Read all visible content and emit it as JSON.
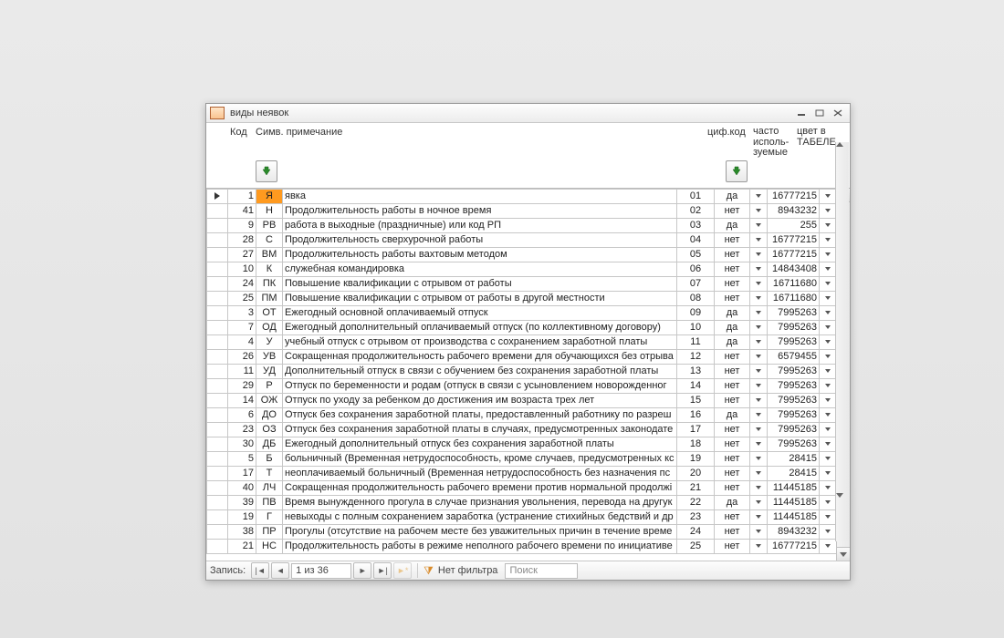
{
  "window": {
    "title": "виды неявок"
  },
  "headers": {
    "kod": "Код",
    "symb": "Симв. примечание",
    "cif": "циф.код",
    "chasto": "часто исполь- зуемые",
    "cvet": "цвет в ТАБЕЛЕ"
  },
  "nav": {
    "label": "Запись:",
    "pos": "1 из 36",
    "filter": "Нет фильтра",
    "search": "Поиск"
  },
  "rows": [
    {
      "sel": true,
      "code": "1",
      "symb": "Я",
      "desc": "явка",
      "cif": "01",
      "freq": "да",
      "color": "16777215"
    },
    {
      "code": "41",
      "symb": "Н",
      "desc": "Продолжительность работы в ночное время",
      "cif": "02",
      "freq": "нет",
      "color": "8943232"
    },
    {
      "code": "9",
      "symb": "РВ",
      "desc": "работа в выходные (праздничные) или код РП",
      "cif": "03",
      "freq": "да",
      "color": "255"
    },
    {
      "code": "28",
      "symb": "С",
      "desc": "Продолжительность сверхурочной работы",
      "cif": "04",
      "freq": "нет",
      "color": "16777215"
    },
    {
      "code": "27",
      "symb": "ВМ",
      "desc": "Продолжительность работы вахтовым методом",
      "cif": "05",
      "freq": "нет",
      "color": "16777215"
    },
    {
      "code": "10",
      "symb": "К",
      "desc": "служебная командировка",
      "cif": "06",
      "freq": "нет",
      "color": "14843408"
    },
    {
      "code": "24",
      "symb": "ПК",
      "desc": "Повышение квалификации с отрывом от работы",
      "cif": "07",
      "freq": "нет",
      "color": "16711680"
    },
    {
      "code": "25",
      "symb": "ПМ",
      "desc": "Повышение квалификации с отрывом от работы в другой местности",
      "cif": "08",
      "freq": "нет",
      "color": "16711680"
    },
    {
      "code": "3",
      "symb": "ОТ",
      "desc": "Ежегодный основной оплачиваемый отпуск",
      "cif": "09",
      "freq": "да",
      "color": "7995263"
    },
    {
      "code": "7",
      "symb": "ОД",
      "desc": "Ежегодный дополнительный оплачиваемый отпуск (по коллективному договору)",
      "cif": "10",
      "freq": "да",
      "color": "7995263"
    },
    {
      "code": "4",
      "symb": "У",
      "desc": "учебный отпуск с отрывом от производства с сохранением заработной платы",
      "cif": "11",
      "freq": "да",
      "color": "7995263"
    },
    {
      "code": "26",
      "symb": "УВ",
      "desc": "Сокращенная продолжительность рабочего времени для обучающихся без отрыва",
      "cif": "12",
      "freq": "нет",
      "color": "6579455"
    },
    {
      "code": "11",
      "symb": "УД",
      "desc": "Дополнительный отпуск в связи с обучением без сохранения заработной платы",
      "cif": "13",
      "freq": "нет",
      "color": "7995263"
    },
    {
      "code": "29",
      "symb": "Р",
      "desc": "Отпуск по беременности и родам (отпуск в связи с усыновлением новорожденног",
      "cif": "14",
      "freq": "нет",
      "color": "7995263"
    },
    {
      "code": "14",
      "symb": "ОЖ",
      "desc": "Отпуск по уходу за ребенком до достижения им возраста трех лет",
      "cif": "15",
      "freq": "нет",
      "color": "7995263"
    },
    {
      "code": "6",
      "symb": "ДО",
      "desc": "Отпуск без сохранения заработной платы, предоставленный работнику по разреш",
      "cif": "16",
      "freq": "да",
      "color": "7995263"
    },
    {
      "code": "23",
      "symb": "ОЗ",
      "desc": "Отпуск без сохранения заработной платы в случаях, предусмотренных законодате",
      "cif": "17",
      "freq": "нет",
      "color": "7995263"
    },
    {
      "code": "30",
      "symb": "ДБ",
      "desc": "Ежегодный дополнительный отпуск без сохранения заработной платы",
      "cif": "18",
      "freq": "нет",
      "color": "7995263"
    },
    {
      "code": "5",
      "symb": "Б",
      "desc": "больничный (Временная нетрудоспособность, кроме случаев, предусмотренных кс",
      "cif": "19",
      "freq": "нет",
      "color": "28415"
    },
    {
      "code": "17",
      "symb": "Т",
      "desc": "неоплачиваемый больничный (Временная нетрудоспособность без назначения пс",
      "cif": "20",
      "freq": "нет",
      "color": "28415"
    },
    {
      "code": "40",
      "symb": "ЛЧ",
      "desc": "Сокращенная продолжительность рабочего времени против нормальной продолжі",
      "cif": "21",
      "freq": "нет",
      "color": "11445185"
    },
    {
      "code": "39",
      "symb": "ПВ",
      "desc": "Время вынужденного прогула в случае признания увольнения, перевода на другук",
      "cif": "22",
      "freq": "да",
      "color": "11445185"
    },
    {
      "code": "19",
      "symb": "Г",
      "desc": "невыходы с полным сохранением заработка (устранение стихийных бедствий и др",
      "cif": "23",
      "freq": "нет",
      "color": "11445185"
    },
    {
      "code": "38",
      "symb": "ПР",
      "desc": "Прогулы (отсутствие на рабочем месте без уважительных причин в течение време",
      "cif": "24",
      "freq": "нет",
      "color": "8943232"
    },
    {
      "code": "21",
      "symb": "НС",
      "desc": "Продолжительность работы в режиме неполного рабочего времени по инициативе",
      "cif": "25",
      "freq": "нет",
      "color": "16777215"
    }
  ]
}
